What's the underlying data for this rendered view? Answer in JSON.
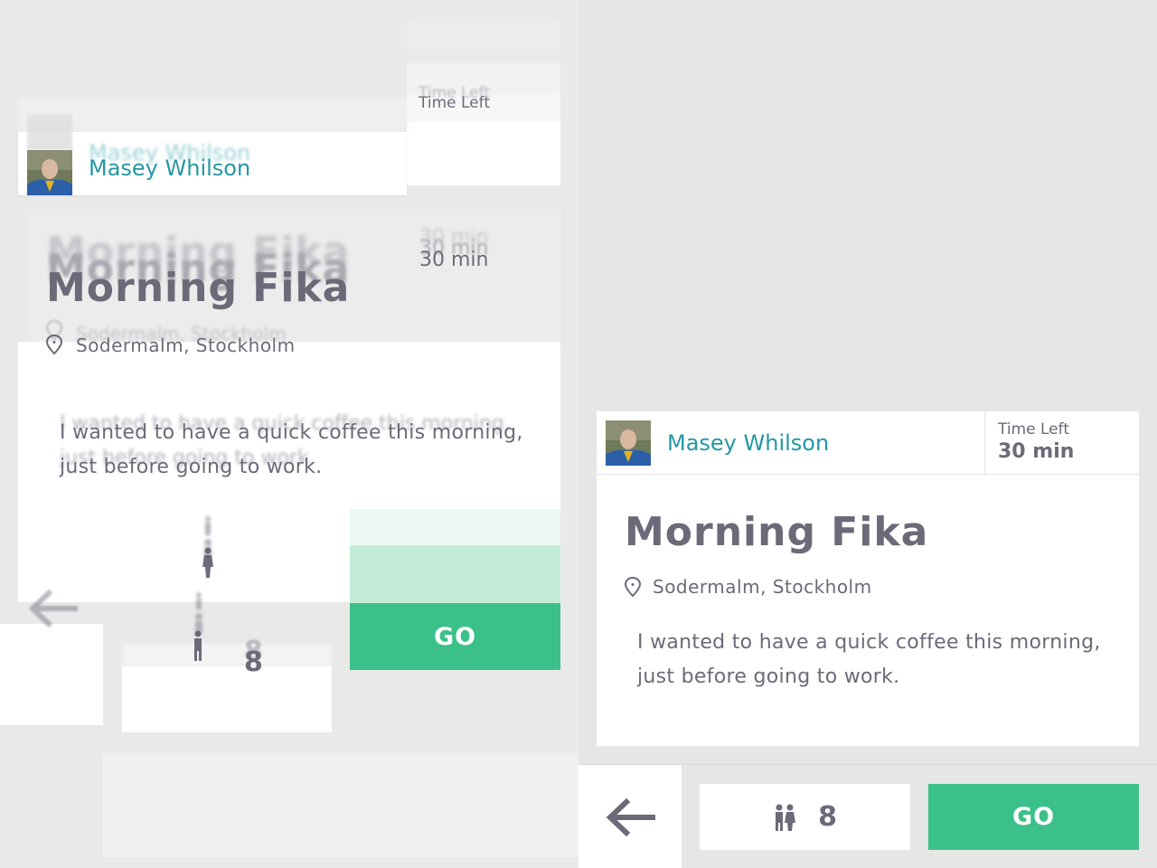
{
  "user": {
    "name": "Masey Whilson"
  },
  "time": {
    "label": "Time Left",
    "value": "30 min"
  },
  "event": {
    "title": "Morning Fika",
    "location": "Sodermalm, Stockholm",
    "description_line1": "I wanted to have a quick coffee this morning,",
    "description_line2": "just before going to work."
  },
  "footer": {
    "people_count": "8",
    "go_label": "GO"
  },
  "icons": {
    "back": "left-arrow-icon",
    "location": "location-pin-icon",
    "people": "people-icon",
    "avatar": "user-avatar"
  },
  "colors": {
    "background": "#e6e6e6",
    "name": "#2497a3",
    "text": "#6b6a78",
    "go": "#3cc08a"
  }
}
